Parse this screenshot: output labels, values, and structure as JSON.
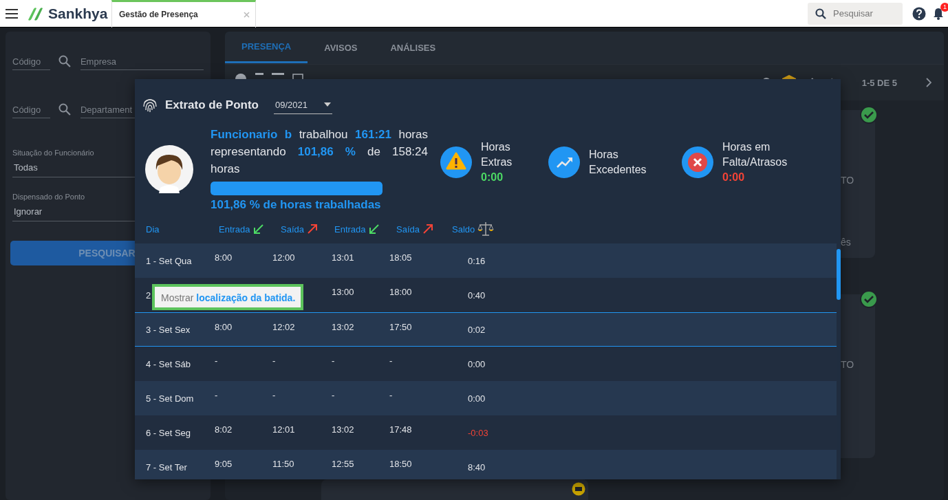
{
  "topbar": {
    "app_name": "Sankhya",
    "tab": {
      "label": "Gestão de Presença",
      "selected": true
    },
    "search": {
      "placeholder": "Pesquisar"
    },
    "notifications": "1"
  },
  "filters": {
    "lookups": [
      {
        "code_placeholder": "Código",
        "name_placeholder": "Empresa"
      },
      {
        "code_placeholder": "Código",
        "name_placeholder": "Departament"
      }
    ],
    "selects": [
      {
        "label": "Situação do Funcionário",
        "value": "Todas"
      },
      {
        "label": "Dispensado do Ponto",
        "value": "Ignorar"
      }
    ],
    "button": "PESQUISAR"
  },
  "tabs": [
    {
      "label": "PRESENÇA",
      "selected": true
    },
    {
      "label": "AVISOS",
      "selected": false
    },
    {
      "label": "ANÁLISES",
      "selected": false
    }
  ],
  "pagination": "1-5 DE 5",
  "cards": [
    {
      "approved": true,
      "texts": [
        "TO",
        "ês"
      ]
    },
    {
      "approved": true,
      "texts": [
        "TO"
      ]
    }
  ],
  "modal": {
    "title": "Extrato de Ponto",
    "month": "09/2021",
    "summary": {
      "sentence": "**Funcionario b** trabalhou **161:21** horas representando **101,86 %** de 158:24 horas",
      "level": 1,
      "caption": "101,86 % de horas trabalhadas"
    },
    "stats": [
      {
        "kind": "warning",
        "label": "Horas Extras",
        "value": "0:00",
        "color": "#4cd964"
      },
      {
        "kind": "trend",
        "label": "Horas Excedentes"
      },
      {
        "kind": "error",
        "label": "Horas em Falta/Atrasos",
        "value": "0:00",
        "color": "#f44336"
      }
    ],
    "columns": [
      {
        "label": "Dia",
        "kind": "day"
      },
      {
        "label": "Entrada",
        "kind": "in"
      },
      {
        "label": "Saída",
        "kind": "out"
      },
      {
        "label": "Entrada",
        "kind": "in"
      },
      {
        "label": "Saída",
        "kind": "out"
      },
      {
        "label": "Saldo",
        "kind": "balance"
      }
    ],
    "rows": [
      {
        "day": "1 - Set Qua",
        "covered": false,
        "times": [
          "8:00",
          "12:00",
          "13:01",
          "18:05"
        ],
        "balance": "0:16",
        "negative": false,
        "selected": false
      },
      {
        "day": "2",
        "covered": true,
        "times": [
          "13:00",
          "18:00"
        ],
        "balance": "0:40",
        "negative": false,
        "selected": false
      },
      {
        "day": "3 - Set Sex",
        "covered": false,
        "times": [
          "8:00",
          "12:02",
          "13:02",
          "17:50"
        ],
        "balance": "0:02",
        "negative": false,
        "selected": true
      },
      {
        "day": "4 - Set Sáb",
        "covered": false,
        "times": [
          "-",
          "-",
          "-",
          "-"
        ],
        "balance": "0:00",
        "negative": false,
        "selected": false
      },
      {
        "day": "5 - Set Dom",
        "covered": false,
        "times": [
          "-",
          "-",
          "-",
          "-"
        ],
        "balance": "0:00",
        "negative": false,
        "selected": false
      },
      {
        "day": "6 - Set Seg",
        "covered": false,
        "times": [
          "8:02",
          "12:01",
          "13:02",
          "17:48"
        ],
        "balance": "-0:03",
        "negative": true,
        "selected": false
      },
      {
        "day": "7 - Set Ter",
        "covered": false,
        "times": [
          "9:05",
          "11:50",
          "12:55",
          "18:50"
        ],
        "balance": "8:40",
        "negative": false,
        "selected": false
      }
    ],
    "tooltip": {
      "text": "Mostrar",
      "link": "localização da batida."
    }
  }
}
